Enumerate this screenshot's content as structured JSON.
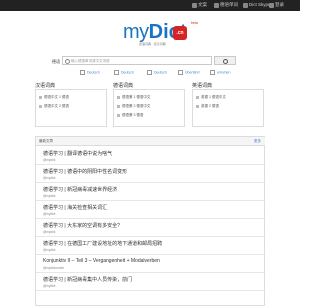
{
  "nav": {
    "items": [
      {
        "label": "文案",
        "icon": "document-icon"
      },
      {
        "label": "德语单词",
        "icon": "book-icon"
      },
      {
        "label": "Dict Skype",
        "icon": "skype-icon"
      },
      {
        "label": "登录",
        "icon": "user-icon"
      }
    ]
  },
  "logo": {
    "my": "my",
    "dict": "Dict",
    "cn": ".cn",
    "beta": "beta",
    "subtitle": "德语词典 · 德汉词典"
  },
  "search": {
    "label": "德语",
    "placeholder": "输入德语单词或中文词语",
    "langs": [
      "Deutsch",
      "Deutsch",
      "Deutsch",
      "Überfahrt",
      "erlochen"
    ]
  },
  "columns": [
    {
      "title": "汉语词典",
      "items": [
        "德语中文 1 德语",
        "德语中文 2 德语"
      ]
    },
    {
      "title": "德语词典",
      "items": [
        "德语第 1 德语中文",
        "德语第 2 德语中文",
        "德语第 3 德语"
      ]
    },
    {
      "title": "英语词典",
      "items": [
        "英德 1 德语中文",
        "英德 2 德语"
      ]
    }
  ],
  "panel": {
    "title": "最新文章",
    "more": "更多",
    "posts": [
      {
        "title": "德语学习 | 翻译德语中说为啥气",
        "user": "@mydict"
      },
      {
        "title": "德语学习 | 德语中的阴阳中性名词变形",
        "user": "@mydict"
      },
      {
        "title": "德语学习 | 新冠病毒减速世界经济",
        "user": "@mydict"
      },
      {
        "title": "德语学习 | 海关检查相关词汇",
        "user": "@mydict"
      },
      {
        "title": "德语学习 | 大东家的空调有多安全?",
        "user": "@mydict"
      },
      {
        "title": "德语学习 | 在德国工厂建设地址的地下通道和邮局招聘",
        "user": "@mydict"
      },
      {
        "title": "Konjunktiv II – Teil 3 – Vergangenheit + Modalverben",
        "user": "@mydictcomm"
      },
      {
        "title": "德语学习 | 新冠病毒集中人员传染，前门",
        "user": "@mydict"
      }
    ]
  }
}
